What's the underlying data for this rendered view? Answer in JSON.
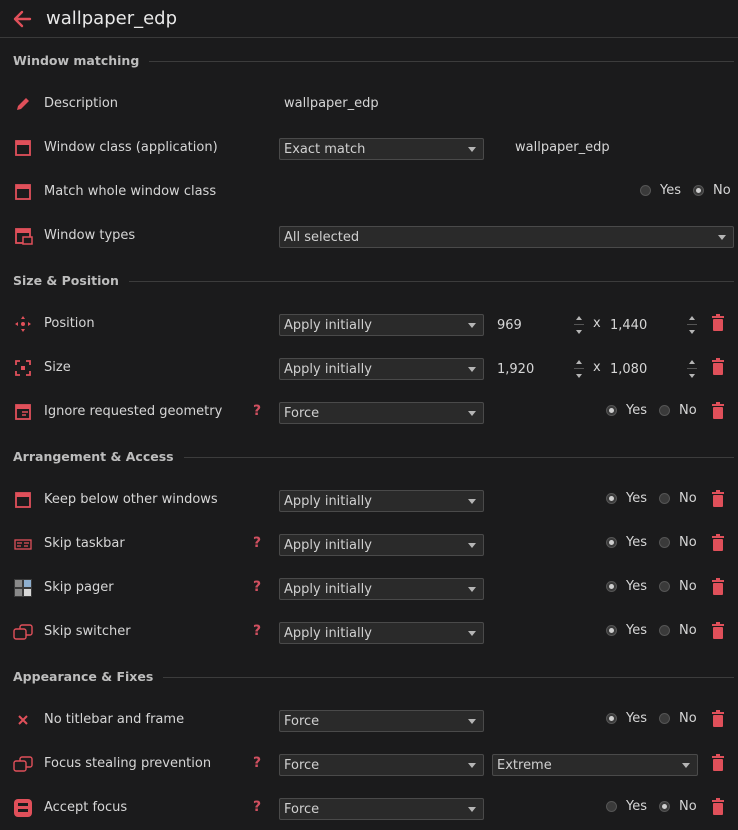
{
  "header": {
    "title": "wallpaper_edp"
  },
  "sections": {
    "window_matching": "Window matching",
    "size_position": "Size & Position",
    "arrangement_access": "Arrangement & Access",
    "appearance_fixes": "Appearance & Fixes"
  },
  "rows": {
    "description": {
      "label": "Description",
      "value": "wallpaper_edp",
      "icon": "pencil-icon"
    },
    "window_class": {
      "label": "Window class (application)",
      "select": "Exact match",
      "value": "wallpaper_edp",
      "icon": "window-icon"
    },
    "match_whole": {
      "label": "Match whole window class",
      "yes": "Yes",
      "no": "No",
      "selected": "No",
      "icon": "window-icon"
    },
    "window_types": {
      "label": "Window types",
      "select": "All selected",
      "icon": "window-types-icon"
    },
    "position": {
      "label": "Position",
      "select": "Apply initially",
      "x": "969",
      "sep": "x",
      "y": "1,440",
      "icon": "move-icon"
    },
    "size": {
      "label": "Size",
      "select": "Apply initially",
      "w": "1,920",
      "sep": "x",
      "h": "1,080",
      "icon": "resize-icon"
    },
    "ignore_geometry": {
      "label": "Ignore requested geometry",
      "help": "?",
      "select": "Force",
      "yes": "Yes",
      "no": "No",
      "selected": "Yes",
      "icon": "geometry-icon"
    },
    "keep_below": {
      "label": "Keep below other windows",
      "select": "Apply initially",
      "yes": "Yes",
      "no": "No",
      "selected": "Yes",
      "icon": "window-icon"
    },
    "skip_taskbar": {
      "label": "Skip taskbar",
      "help": "?",
      "select": "Apply initially",
      "yes": "Yes",
      "no": "No",
      "selected": "Yes",
      "icon": "taskbar-icon"
    },
    "skip_pager": {
      "label": "Skip pager",
      "help": "?",
      "select": "Apply initially",
      "yes": "Yes",
      "no": "No",
      "selected": "Yes",
      "icon": "pager-icon"
    },
    "skip_switcher": {
      "label": "Skip switcher",
      "help": "?",
      "select": "Apply initially",
      "yes": "Yes",
      "no": "No",
      "selected": "Yes",
      "icon": "switcher-icon"
    },
    "no_titlebar": {
      "label": "No titlebar and frame",
      "select": "Force",
      "yes": "Yes",
      "no": "No",
      "selected": "Yes",
      "icon": "close-x-icon"
    },
    "focus_stealing": {
      "label": "Focus stealing prevention",
      "help": "?",
      "select": "Force",
      "select2": "Extreme",
      "icon": "switcher-icon"
    },
    "accept_focus": {
      "label": "Accept focus",
      "help": "?",
      "select": "Force",
      "yes": "Yes",
      "no": "No",
      "selected": "No",
      "icon": "accept-focus-icon"
    }
  },
  "colors": {
    "accent": "#e0505a",
    "background": "#1b1b1c",
    "field": "#2a2a2a"
  }
}
